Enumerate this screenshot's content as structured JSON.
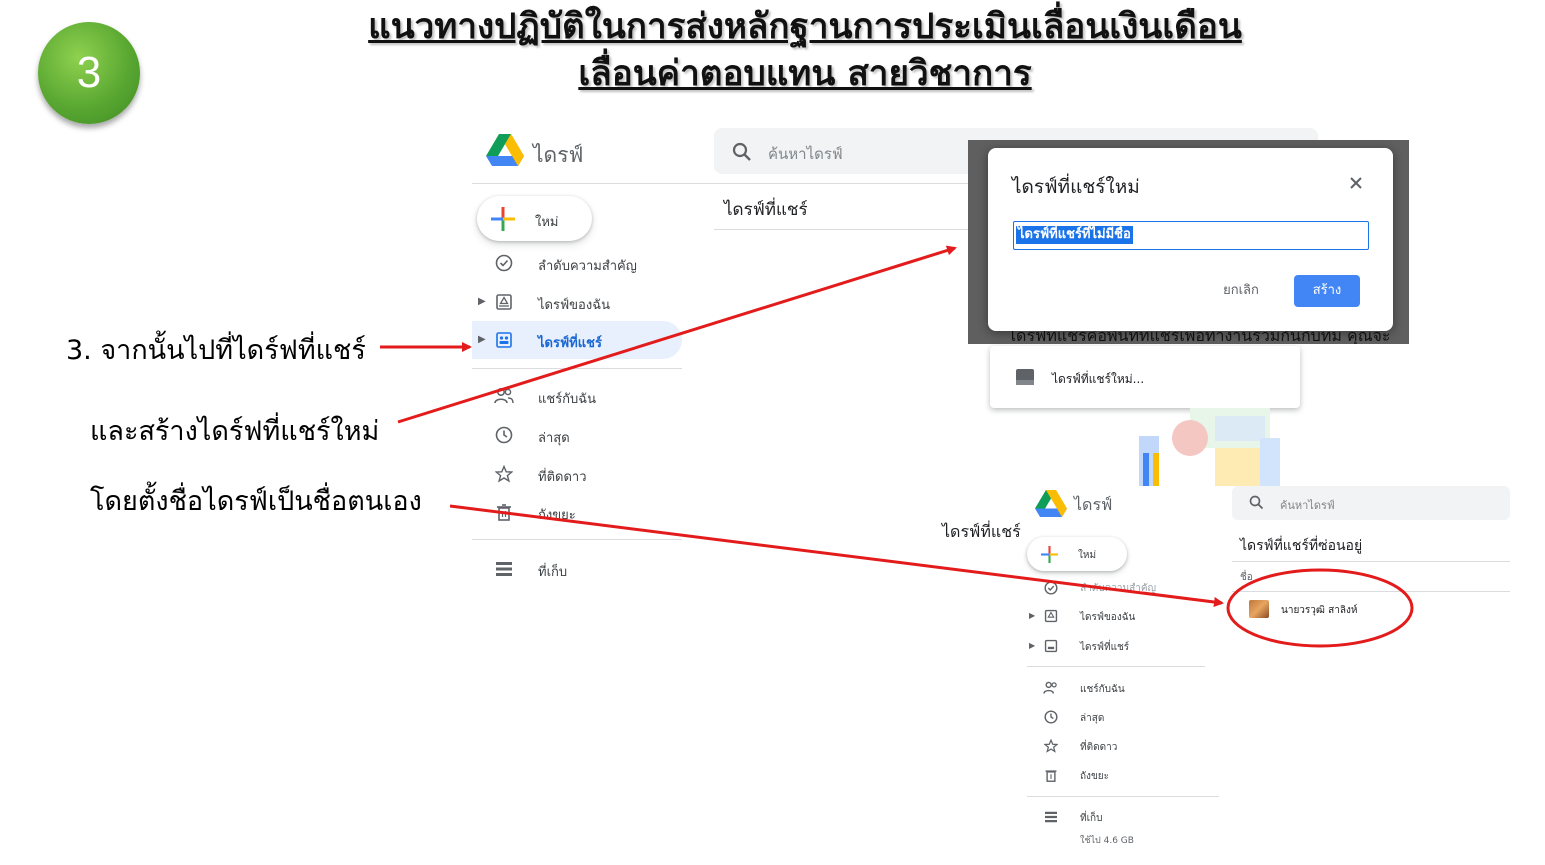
{
  "step_number": "3",
  "title": {
    "line1": "แนวทางปฏิบัติในการส่งหลักฐานการประเมินเลื่อนเงินเดือน",
    "line2": "เลื่อนค่าตอบแทน สายวิชาการ"
  },
  "notes": {
    "step": "3. จากนั้นไปที่ไดร์ฟที่แชร์",
    "create": "และสร้างไดร์ฟที่แชร์ใหม่",
    "name": "โดยตั้งชื่อไดรฟ์เป็นชื่อตนเอง"
  },
  "drive_main": {
    "app_name": "ไดรฟ์",
    "search_placeholder": "ค้นหาไดรฟ์",
    "new_label": "ใหม่",
    "page_heading": "ไดรฟ์ที่แชร์",
    "nav": [
      {
        "label": "ลำดับความสำคัญ",
        "icon": "priority-check-icon"
      },
      {
        "label": "ไดรฟ์ของฉัน",
        "icon": "my-drive-icon"
      },
      {
        "label": "ไดรฟ์ที่แชร์",
        "icon": "shared-drives-icon"
      },
      {
        "label": "แชร์กับฉัน",
        "icon": "people-icon"
      },
      {
        "label": "ล่าสุด",
        "icon": "clock-icon"
      },
      {
        "label": "ที่ติดดาว",
        "icon": "star-icon"
      },
      {
        "label": "ถังขยะ",
        "icon": "trash-icon"
      },
      {
        "label": "ที่เก็บ",
        "icon": "storage-icon"
      }
    ]
  },
  "dialog": {
    "title": "ไดรฟ์ที่แชร์ใหม่",
    "input_value": "ไดรฟ์ที่แชร์ที่ไม่มีชื่อ",
    "cancel": "ยกเลิก",
    "create": "สร้าง",
    "bg_text": "ไดรฟ์ที่แชร์คือพื้นที่ที่แชร์เพื่อทำงานร่วมกันกับทีม คุณจะ"
  },
  "popup": {
    "item_label": "ไดรฟ์ที่แชร์ใหม่..."
  },
  "drive_second": {
    "app_name": "ไดรฟ์",
    "search_placeholder": "ค้นหาไดรฟ์",
    "new_label": "ใหม่",
    "heading_cut": "ไดรฟ์ที่แชร์",
    "page_heading": "ไดรฟ์ที่แชร์ที่ซ่อนอยู่",
    "column_name": "ชื่อ",
    "item_name": "นายวรวุฒิ สาลิงห์",
    "nav": [
      {
        "label": "ลำดับความสำคัญ",
        "icon": "priority-check-icon"
      },
      {
        "label": "ไดรฟ์ของฉัน",
        "icon": "my-drive-icon"
      },
      {
        "label": "ไดรฟ์ที่แชร์",
        "icon": "shared-drives-icon"
      },
      {
        "label": "แชร์กับฉัน",
        "icon": "people-icon"
      },
      {
        "label": "ล่าสุด",
        "icon": "clock-icon"
      },
      {
        "label": "ที่ติดดาว",
        "icon": "star-icon"
      },
      {
        "label": "ถังขยะ",
        "icon": "trash-icon"
      },
      {
        "label": "ที่เก็บ",
        "icon": "storage-icon"
      }
    ],
    "storage_used": "ใช้ไป 4.6 GB"
  },
  "colors": {
    "accent_blue": "#1a73e8",
    "arrow_red": "#e31b1b",
    "badge_green": "#5aa832"
  }
}
